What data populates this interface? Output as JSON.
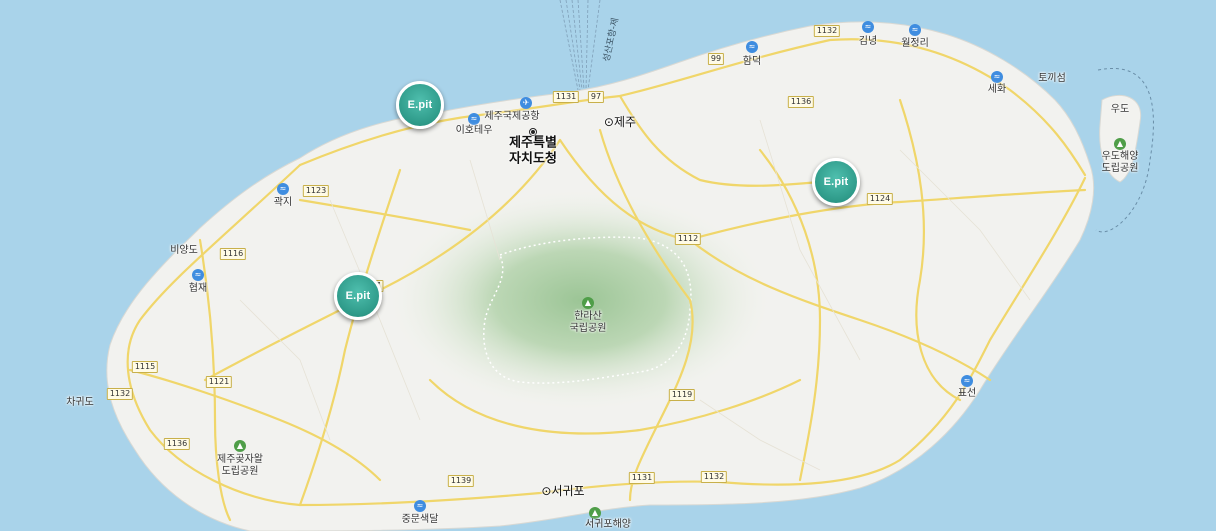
{
  "colors": {
    "sea": "#a9d3ea",
    "land": "#f2f2ef",
    "road": "#f0d66a",
    "marker": "#2e9a89",
    "park": "#d4e6cf"
  },
  "city_labels": [
    {
      "text": "제주특별\n자치도청",
      "kind": "big",
      "icon": "capital-dot"
    },
    {
      "text": "⊙제주",
      "kind": "city"
    },
    {
      "text": "⊙서귀포",
      "kind": "city"
    }
  ],
  "place_labels": [
    {
      "text": "제주국제공항"
    },
    {
      "text": "이호테우"
    },
    {
      "text": "함덕"
    },
    {
      "text": "김녕"
    },
    {
      "text": "월정리"
    },
    {
      "text": "세화"
    },
    {
      "text": "토끼섬"
    },
    {
      "text": "우도"
    },
    {
      "text": "우도해양\n도립공원"
    },
    {
      "text": "곽지"
    },
    {
      "text": "비양도"
    },
    {
      "text": "협재"
    },
    {
      "text": "한라산\n국립공원"
    },
    {
      "text": "표선"
    },
    {
      "text": "차귀도"
    },
    {
      "text": "제주곶자왈\n도립공원"
    },
    {
      "text": "중문색달"
    },
    {
      "text": "서귀포해양"
    },
    {
      "text": "성산포항-제"
    }
  ],
  "road_shields": [
    "1132",
    "99",
    "1136",
    "1131",
    "97",
    "1123",
    "1124",
    "1112",
    "1116",
    "1115",
    "1121",
    "1132",
    "1136",
    "1119",
    "1139",
    "1131",
    "1132",
    "7"
  ],
  "poi_icons": [
    "airport-icon",
    "beach-icon",
    "beach-icon",
    "beach-icon",
    "beach-icon",
    "beach-icon",
    "beach-icon",
    "beach-icon",
    "park-icon",
    "park-icon",
    "park-icon",
    "park-icon",
    "beach-icon"
  ],
  "markers": [
    {
      "label": "E.pit"
    },
    {
      "label": "E.pit"
    },
    {
      "label": "E.pit"
    }
  ]
}
